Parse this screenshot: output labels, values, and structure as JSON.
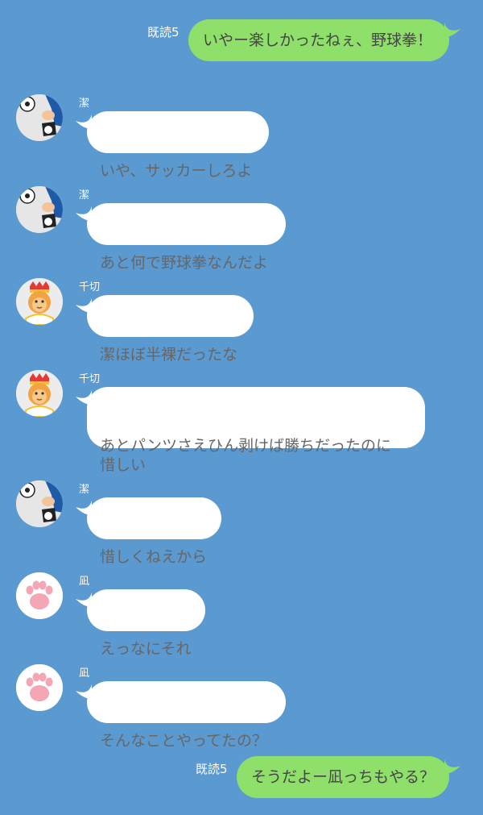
{
  "colors": {
    "background": "#5b99d1",
    "outgoing": "#8fe06a",
    "incoming": "#ffffff"
  },
  "messages": [
    {
      "type": "out",
      "read": "既読5",
      "text": "いやー楽しかったねぇ、野球拳！"
    },
    {
      "type": "in",
      "sender": "潔",
      "avatar": "soccer-boy-icon",
      "text": "いや、サッカーしろよ"
    },
    {
      "type": "in",
      "sender": "潔",
      "avatar": "soccer-boy-icon",
      "text": "あと何で野球拳なんだよ"
    },
    {
      "type": "in",
      "sender": "千切",
      "avatar": "lion-king-icon",
      "text": "潔ほぼ半裸だったな"
    },
    {
      "type": "in",
      "sender": "千切",
      "avatar": "lion-king-icon",
      "text": "あとパンツさえひん剥けば勝ちだったのに\n惜しい"
    },
    {
      "type": "in",
      "sender": "潔",
      "avatar": "soccer-boy-icon",
      "text": "惜しくねえから"
    },
    {
      "type": "in",
      "sender": "凪",
      "avatar": "cat-paw-icon",
      "text": "えっなにそれ"
    },
    {
      "type": "in",
      "sender": "凪",
      "avatar": "cat-paw-icon",
      "text": "そんなことやってたの？"
    },
    {
      "type": "out",
      "read": "既読5",
      "text": "そうだよー凪っちもやる？"
    }
  ]
}
